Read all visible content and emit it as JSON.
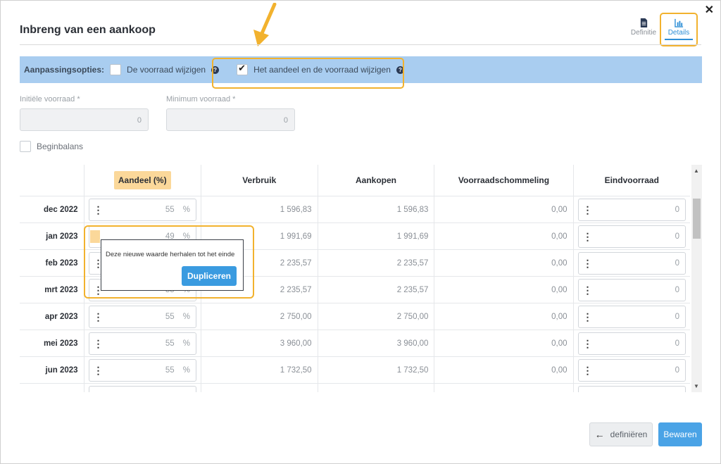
{
  "close_icon": "close-icon",
  "title": "Inbreng van een aankoop",
  "tabs": [
    {
      "label": "Definitie",
      "icon": "document-icon"
    },
    {
      "label": "Details",
      "icon": "chart-icon"
    }
  ],
  "options": {
    "label": "Aanpassingsopties:",
    "opt1": "De voorraad wijzigen",
    "opt2": "Het aandeel en de voorraad wijzigen"
  },
  "fields": {
    "initial_label": "Initiële voorraad *",
    "initial_value": "0",
    "minimum_label": "Minimum voorraad *",
    "minimum_value": "0"
  },
  "beginbalans": "Beginbalans",
  "table": {
    "headers": [
      "Aandeel (%)",
      "Verbruik",
      "Aankopen",
      "Voorraadschommeling",
      "Eindvoorraad"
    ],
    "rows": [
      {
        "month": "dec 2022",
        "aandeel": "55",
        "verbruik": "1 596,83",
        "aankopen": "1 596,83",
        "schommeling": "0,00",
        "eind": "0"
      },
      {
        "month": "jan 2023",
        "aandeel": "49",
        "verbruik": "1 991,69",
        "aankopen": "1 991,69",
        "schommeling": "0,00",
        "eind": "0"
      },
      {
        "month": "feb 2023",
        "aandeel": "",
        "verbruik": "2 235,57",
        "aankopen": "2 235,57",
        "schommeling": "0,00",
        "eind": "0"
      },
      {
        "month": "mrt 2023",
        "aandeel": "55",
        "verbruik": "2 235,57",
        "aankopen": "2 235,57",
        "schommeling": "0,00",
        "eind": "0"
      },
      {
        "month": "apr 2023",
        "aandeel": "55",
        "verbruik": "2 750,00",
        "aankopen": "2 750,00",
        "schommeling": "0,00",
        "eind": "0"
      },
      {
        "month": "mei 2023",
        "aandeel": "55",
        "verbruik": "3 960,00",
        "aankopen": "3 960,00",
        "schommeling": "0,00",
        "eind": "0"
      },
      {
        "month": "jun 2023",
        "aandeel": "55",
        "verbruik": "1 732,50",
        "aankopen": "1 732,50",
        "schommeling": "0,00",
        "eind": "0"
      }
    ],
    "percent": "%"
  },
  "popup": {
    "message": "Deze nieuwe waarde herhalen tot het einde",
    "button": "Dupliceren"
  },
  "footer": {
    "define_button": "definiëren",
    "save_button": "Bewaren"
  },
  "colors": {
    "accent": "#3a9be0",
    "highlight": "#f2b22e",
    "options_bar": "#a9cdf0"
  }
}
